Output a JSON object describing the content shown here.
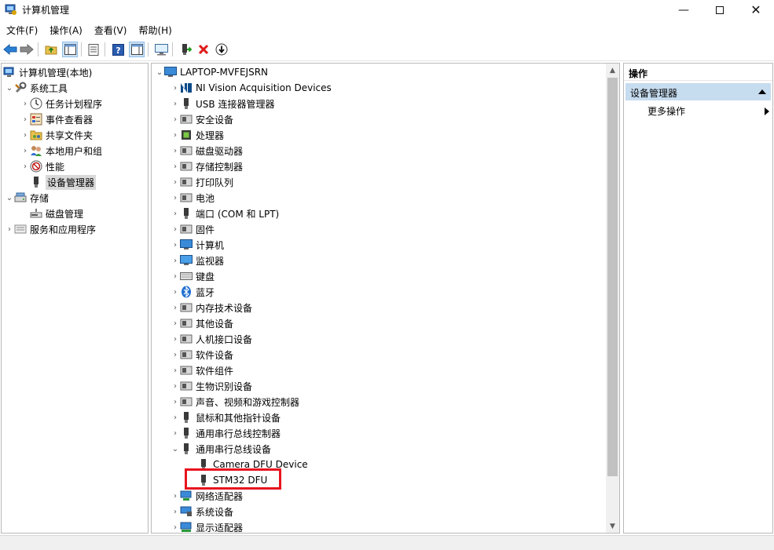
{
  "window": {
    "title": "计算机管理",
    "minimize_icon": "minimize-icon",
    "maximize_icon": "maximize-icon",
    "close_icon": "close-icon"
  },
  "menu": [
    "文件(F)",
    "操作(A)",
    "查看(V)",
    "帮助(H)"
  ],
  "toolbar": {
    "buttons": [
      "back-arrow-icon",
      "forward-arrow-icon",
      "up-folder-icon",
      "show-hide-tree-icon",
      "properties-icon",
      "help-icon",
      "show-action-pane-icon",
      "monitor-icon",
      "update-driver-icon",
      "uninstall-icon",
      "scan-hardware-icon"
    ]
  },
  "left_tree": {
    "root": "计算机管理(本地)",
    "system_tools": "系统工具",
    "task_scheduler": "任务计划程序",
    "event_viewer": "事件查看器",
    "shared_folders": "共享文件夹",
    "local_users": "本地用户和组",
    "performance": "性能",
    "device_manager": "设备管理器",
    "storage": "存储",
    "disk_management": "磁盘管理",
    "services_apps": "服务和应用程序"
  },
  "device_tree": {
    "root": "LAPTOP-MVFEJSRN",
    "categories": [
      "NI Vision Acquisition Devices",
      "USB 连接器管理器",
      "安全设备",
      "处理器",
      "磁盘驱动器",
      "存储控制器",
      "打印队列",
      "电池",
      "端口 (COM 和 LPT)",
      "固件",
      "计算机",
      "监视器",
      "键盘",
      "蓝牙",
      "内存技术设备",
      "其他设备",
      "人机接口设备",
      "软件设备",
      "软件组件",
      "生物识别设备",
      "声音、视频和游戏控制器",
      "鼠标和其他指针设备",
      "通用串行总线控制器",
      "通用串行总线设备"
    ],
    "usb_children": [
      "Camera DFU Device",
      "STM32 DFU"
    ],
    "after": [
      "网络适配器",
      "系统设备",
      "显示适配器"
    ]
  },
  "actions": {
    "header": "操作",
    "section": "设备管理器",
    "more": "更多操作"
  },
  "colors": {
    "selection": "#d9d9d9",
    "action_section": "#c6dcef",
    "highlight_box": "#e8141e"
  }
}
